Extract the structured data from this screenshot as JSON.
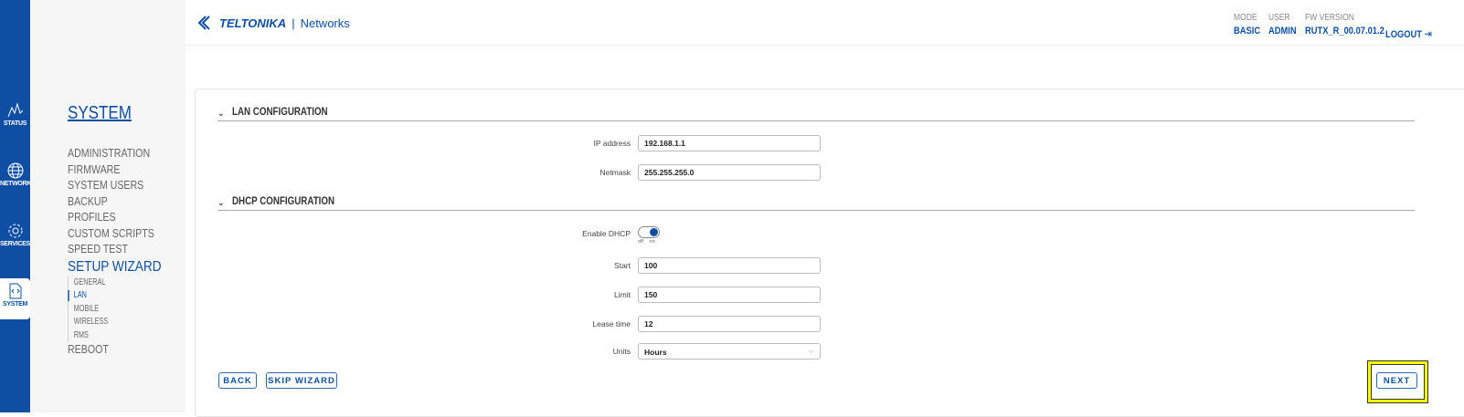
{
  "rail": [
    {
      "label": "STATUS",
      "icon": "pulse-icon"
    },
    {
      "label": "NETWORK",
      "icon": "globe-icon"
    },
    {
      "label": "SERVICES",
      "icon": "gear-icon"
    },
    {
      "label": "SYSTEM",
      "icon": "code-file-icon"
    }
  ],
  "sidebar": {
    "title": "SYSTEM",
    "items": [
      "ADMINISTRATION",
      "FIRMWARE",
      "SYSTEM USERS",
      "BACKUP",
      "PROFILES",
      "CUSTOM SCRIPTS",
      "SPEED TEST"
    ],
    "wizard": "SETUP WIZARD",
    "wizard_items": [
      "GENERAL",
      "LAN",
      "MOBILE",
      "WIRELESS",
      "RMS"
    ],
    "reboot": "REBOOT"
  },
  "header": {
    "brand": "TELTONIKA",
    "sep": "|",
    "sub": "Networks",
    "mode_label": "MODE",
    "mode": "BASIC",
    "user_label": "USER",
    "user": "ADMIN",
    "fw_label": "FW VERSION",
    "fw": "RUTX_R_00.07.01.2",
    "logout": "LOGOUT"
  },
  "lan": {
    "title": "LAN CONFIGURATION",
    "ip_label": "IP address",
    "ip": "192.168.1.1",
    "mask_label": "Netmask",
    "mask": "255.255.255.0"
  },
  "dhcp": {
    "title": "DHCP CONFIGURATION",
    "enable_label": "Enable DHCP",
    "enabled": true,
    "off": "off",
    "on": "on",
    "start_label": "Start",
    "start": "100",
    "limit_label": "Limit",
    "limit": "150",
    "lease_label": "Lease time",
    "lease": "12",
    "units_label": "Units",
    "units": "Hours"
  },
  "buttons": {
    "back": "BACK",
    "skip": "SKIP WIZARD",
    "next": "NEXT"
  },
  "colors": {
    "accent": "#0e4fa3",
    "highlight": "#ffff00"
  }
}
